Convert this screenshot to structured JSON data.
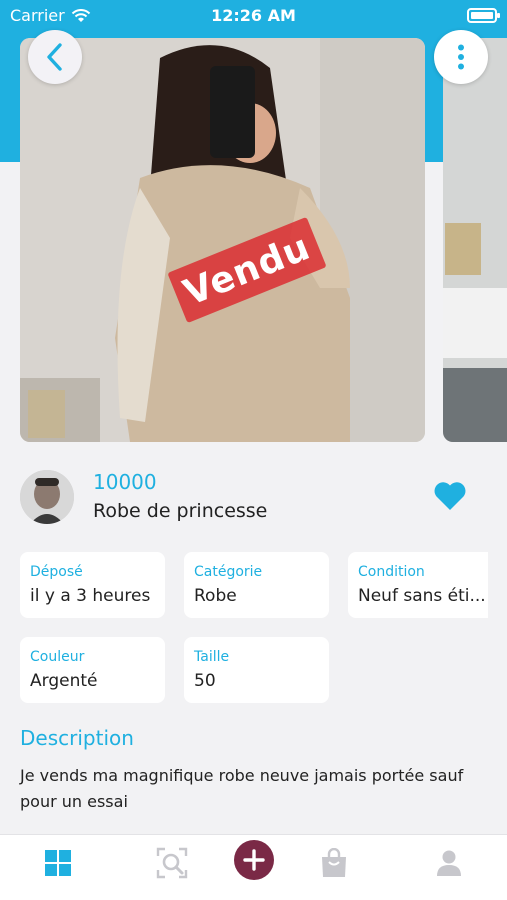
{
  "status_bar": {
    "carrier": "Carrier",
    "time": "12:26 AM"
  },
  "icons": {
    "back": "chevron-left-icon",
    "more": "more-vertical-icon",
    "favorite": "heart-icon",
    "tabs": [
      "grid-icon",
      "search-icon",
      "plus-icon",
      "shopping-bag-icon",
      "person-icon"
    ]
  },
  "product": {
    "sold_label": "Vendu",
    "price": "10000",
    "title": "Robe de princesse"
  },
  "details": [
    {
      "label": "Déposé",
      "value": "il y a 3 heures"
    },
    {
      "label": "Catégorie",
      "value": "Robe"
    },
    {
      "label": "Condition",
      "value": "Neuf sans éti..."
    },
    {
      "label": "Couleur",
      "value": "Argenté"
    },
    {
      "label": "Taille",
      "value": "50"
    }
  ],
  "description": {
    "heading": "Description",
    "text": "Je vends ma magnifique robe neuve jamais portée sauf pour un essai"
  },
  "colors": {
    "accent": "#1fb0e0",
    "add_button": "#7a2946",
    "sold_stamp": "#dc282d",
    "tab_inactive": "#c7c7cc"
  }
}
